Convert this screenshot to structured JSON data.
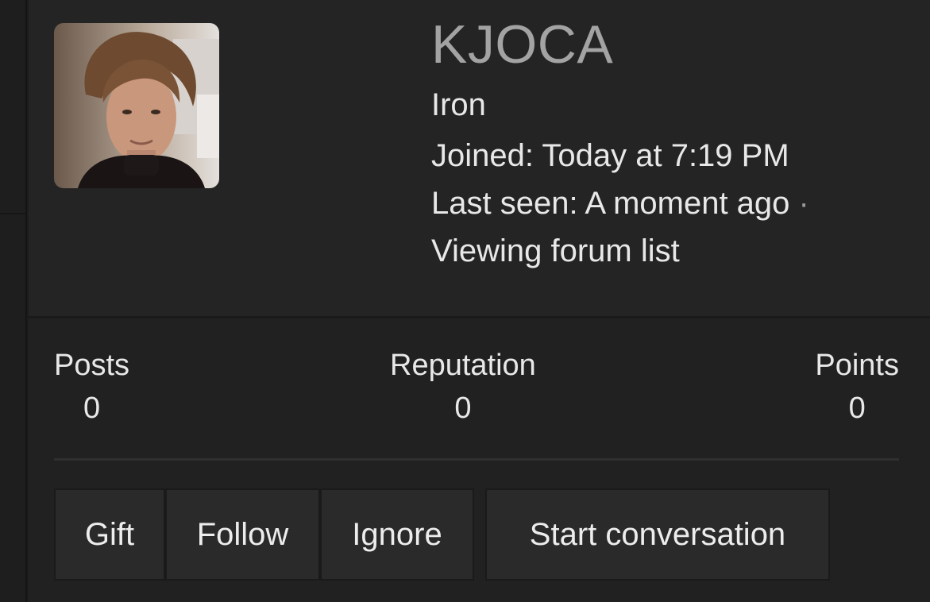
{
  "profile": {
    "username": "KJOCA",
    "rank": "Iron",
    "joined_label": "Joined:",
    "joined_value": "Today at 7:19 PM",
    "last_seen_label": "Last seen:",
    "last_seen_value": "A moment ago",
    "separator": "·",
    "activity": "Viewing forum list"
  },
  "stats": {
    "posts_label": "Posts",
    "posts_value": "0",
    "reputation_label": "Reputation",
    "reputation_value": "0",
    "points_label": "Points",
    "points_value": "0"
  },
  "actions": {
    "gift": "Gift",
    "follow": "Follow",
    "ignore": "Ignore",
    "start_conversation": "Start conversation"
  },
  "colors": {
    "background": "#1c1c1c",
    "card": "#212121",
    "header": "#242424",
    "username": "#a3a3a3",
    "text": "#e8e8e8",
    "button": "#2a2a2a"
  }
}
